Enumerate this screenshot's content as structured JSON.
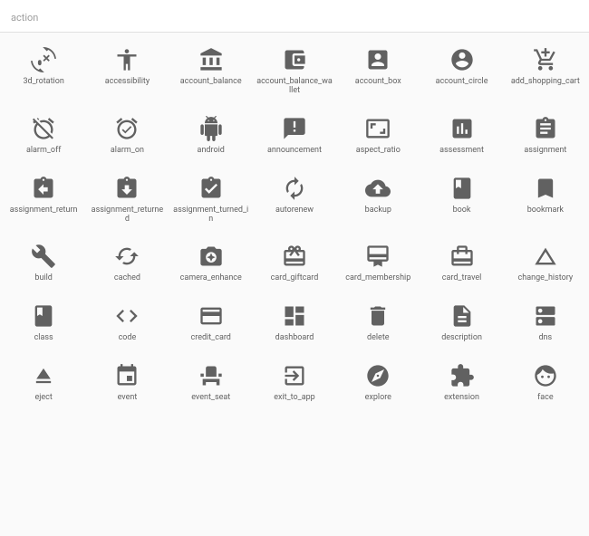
{
  "header": {
    "title": "action"
  },
  "icons": [
    {
      "label": "3d_rotation",
      "icon": "3d-rotation-icon"
    },
    {
      "label": "accessibility",
      "icon": "accessibility-icon"
    },
    {
      "label": "account_balance",
      "icon": "account-balance-icon"
    },
    {
      "label": "account_balance_wallet",
      "icon": "account-balance-wallet-icon"
    },
    {
      "label": "account_box",
      "icon": "account-box-icon"
    },
    {
      "label": "account_circle",
      "icon": "account-circle-icon"
    },
    {
      "label": "add_shopping_cart",
      "icon": "add-shopping-cart-icon"
    },
    {
      "label": "alarm_off",
      "icon": "alarm-off-icon"
    },
    {
      "label": "alarm_on",
      "icon": "alarm-on-icon"
    },
    {
      "label": "android",
      "icon": "android-icon"
    },
    {
      "label": "announcement",
      "icon": "announcement-icon"
    },
    {
      "label": "aspect_ratio",
      "icon": "aspect-ratio-icon"
    },
    {
      "label": "assessment",
      "icon": "assessment-icon"
    },
    {
      "label": "assignment",
      "icon": "assignment-icon"
    },
    {
      "label": "assignment_return",
      "icon": "assignment-return-icon"
    },
    {
      "label": "assignment_returned",
      "icon": "assignment-returned-icon"
    },
    {
      "label": "assignment_turned_in",
      "icon": "assignment-turned-in-icon"
    },
    {
      "label": "autorenew",
      "icon": "autorenew-icon"
    },
    {
      "label": "backup",
      "icon": "backup-icon"
    },
    {
      "label": "book",
      "icon": "book-icon"
    },
    {
      "label": "bookmark",
      "icon": "bookmark-icon"
    },
    {
      "label": "build",
      "icon": "build-icon"
    },
    {
      "label": "cached",
      "icon": "cached-icon"
    },
    {
      "label": "camera_enhance",
      "icon": "camera-enhance-icon"
    },
    {
      "label": "card_giftcard",
      "icon": "card-giftcard-icon"
    },
    {
      "label": "card_membership",
      "icon": "card-membership-icon"
    },
    {
      "label": "card_travel",
      "icon": "card-travel-icon"
    },
    {
      "label": "change_history",
      "icon": "change-history-icon"
    },
    {
      "label": "class",
      "icon": "class-icon"
    },
    {
      "label": "code",
      "icon": "code-icon"
    },
    {
      "label": "credit_card",
      "icon": "credit-card-icon"
    },
    {
      "label": "dashboard",
      "icon": "dashboard-icon"
    },
    {
      "label": "delete",
      "icon": "delete-icon"
    },
    {
      "label": "description",
      "icon": "description-icon"
    },
    {
      "label": "dns",
      "icon": "dns-icon"
    },
    {
      "label": "eject",
      "icon": "eject-icon"
    },
    {
      "label": "event",
      "icon": "event-icon"
    },
    {
      "label": "event_seat",
      "icon": "event-seat-icon"
    },
    {
      "label": "exit_to_app",
      "icon": "exit-to-app-icon"
    },
    {
      "label": "explore",
      "icon": "explore-icon"
    },
    {
      "label": "extension",
      "icon": "extension-icon"
    },
    {
      "label": "face",
      "icon": "face-icon"
    }
  ]
}
